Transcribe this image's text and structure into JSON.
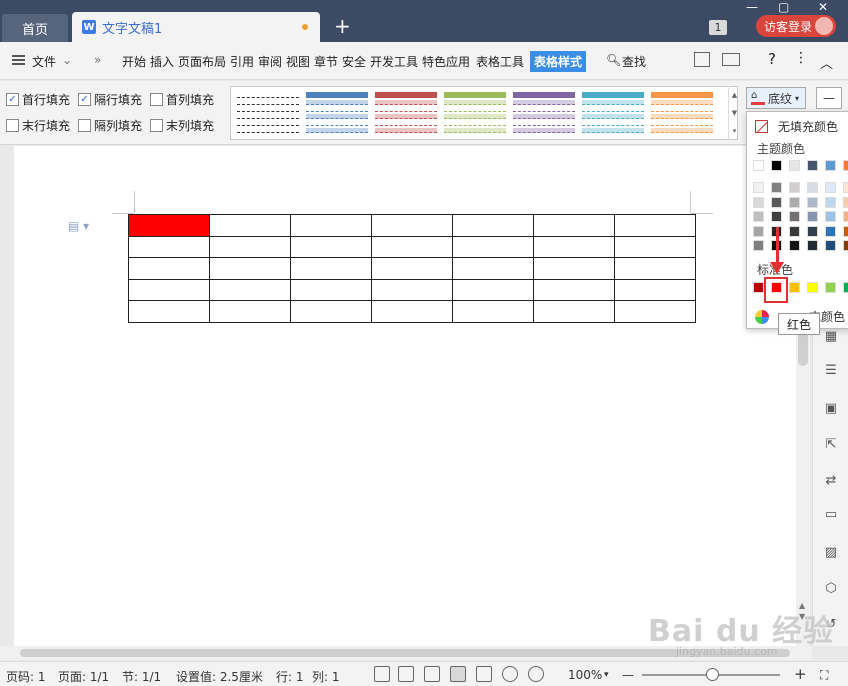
{
  "tabbar": {
    "home_label": "首页",
    "doc_icon": "W",
    "doc_title": "文字文稿1",
    "new_tab": "+",
    "window_count": "1",
    "login_label": "访客登录"
  },
  "menubar": {
    "file_label": "文件",
    "items": [
      "开始",
      "插入",
      "页面布局",
      "引用",
      "审阅",
      "视图",
      "章节",
      "安全",
      "开发工具",
      "特色应用",
      "表格工具",
      "表格样式"
    ],
    "active_item": "表格样式",
    "search_label": "查找",
    "help": "?"
  },
  "ribbon": {
    "checkboxes": [
      {
        "label": "首行填充",
        "checked": true
      },
      {
        "label": "隔行填充",
        "checked": true
      },
      {
        "label": "首列填充",
        "checked": false
      },
      {
        "label": "末行填充",
        "checked": false
      },
      {
        "label": "隔列填充",
        "checked": false
      },
      {
        "label": "末列填充",
        "checked": false
      }
    ],
    "style_colors": [
      "#ffffff",
      "#4f81bd",
      "#c0504d",
      "#9bbb59",
      "#8064a2",
      "#4bacc6",
      "#f79646"
    ],
    "shading_label": "底纹"
  },
  "dropdown": {
    "no_fill": "无填充颜色",
    "theme_colors_label": "主题颜色",
    "standard_colors_label": "标准色",
    "tooltip": "红色",
    "more_colors": "充颜色",
    "theme_top_row": [
      "#ffffff",
      "#000000",
      "#e7e6e6",
      "#44546a",
      "#5b9bd5",
      "#ed7d31"
    ],
    "standard_colors": [
      "#c00000",
      "#ff0000",
      "#ffc000",
      "#ffff00",
      "#92d050",
      "#00b050"
    ]
  },
  "table": {
    "rows": 5,
    "cols": 7,
    "filled_cell_color": "#ff0000"
  },
  "statusbar": {
    "page_code": "页码: 1",
    "page": "页面: 1/1",
    "section": "节: 1/1",
    "setting": "设置值: 2.5厘米",
    "row": "行: 1",
    "col": "列: 1",
    "zoom": "100%"
  },
  "watermark": {
    "text": "Bai du 经验",
    "sub": "jingyan.baidu.com"
  }
}
